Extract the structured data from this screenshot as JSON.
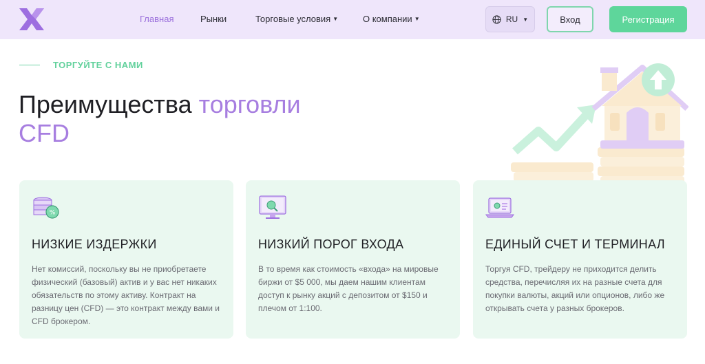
{
  "header": {
    "nav": [
      {
        "label": "Главная",
        "active": true,
        "dropdown": false
      },
      {
        "label": "Рынки",
        "active": false,
        "dropdown": false
      },
      {
        "label": "Торговые условия",
        "active": false,
        "dropdown": true
      },
      {
        "label": "О компании",
        "active": false,
        "dropdown": true
      }
    ],
    "language": "RU",
    "login_label": "Вход",
    "register_label": "Регистрация"
  },
  "hero": {
    "eyebrow": "ТОРГУЙТЕ С НАМИ",
    "title_part1": "Преимущества ",
    "title_accent": "торговли CFD"
  },
  "cards": [
    {
      "icon": "coins-percent-icon",
      "title": "НИЗКИЕ ИЗДЕРЖКИ",
      "text": "Нет комиссий, поскольку вы не приобретаете физический (базовый) актив и у вас нет никаких обязательств по этому активу. Контракт на разницу цен (CFD) — это контракт между вами и CFD брокером."
    },
    {
      "icon": "monitor-search-icon",
      "title": "НИЗКИЙ ПОРОГ ВХОДА",
      "text": "В то время как стоимость «входа» на мировые биржи от $5 000, мы даем нашим клиентам доступ к рынку акций с депозитом от $150 и плечом от 1:100."
    },
    {
      "icon": "laptop-card-icon",
      "title": "ЕДИНЫЙ СЧЕТ И ТЕРМИНАЛ",
      "text": "Торгуя CFD, трейдеру не приходится делить средства, перечисляя их на разные счета для покупки валюты, акций или опционов, либо же открывать счета у разных брокеров."
    }
  ],
  "colors": {
    "header_bg": "#efe6fb",
    "accent_purple": "#a77ee0",
    "accent_green": "#5ed69b",
    "card_bg": "#eaf8f0"
  }
}
